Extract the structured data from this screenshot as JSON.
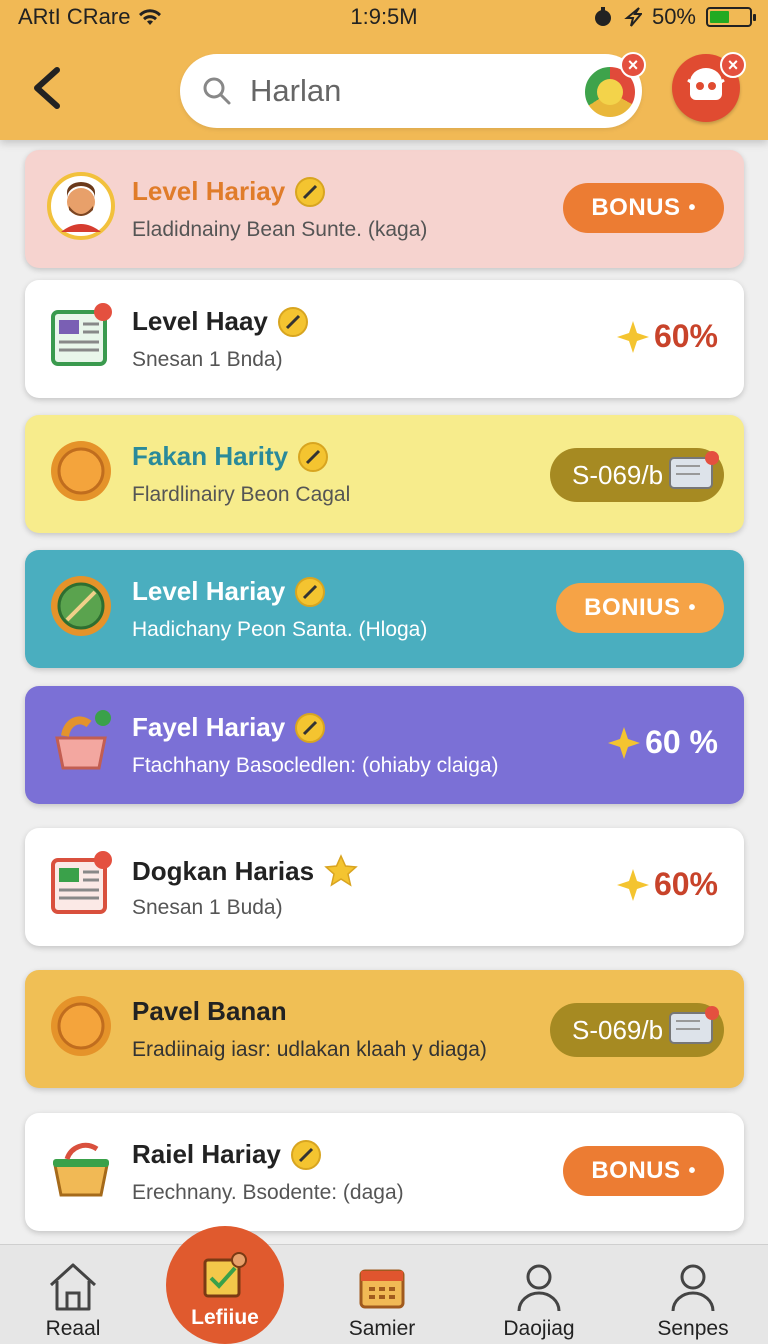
{
  "status_bar": {
    "carrier": "ARtI CRare",
    "time": "1:9:5M",
    "battery": "50%"
  },
  "header": {
    "search_value": "Harlan"
  },
  "cards": [
    {
      "title": "Level Hariay",
      "subtitle": "Eladidnainy Bean Sunte. (kaga)",
      "badge": "BONUS",
      "bg": "#f6d3cf"
    },
    {
      "title": "Level Haay",
      "subtitle": "Snesan 1 Bnda)",
      "percent": "60%",
      "bg": "#ffffff"
    },
    {
      "title": "Fakan Harity",
      "subtitle": "Flardlinairy Beon Cagal",
      "price": "S-069/b",
      "bg": "#f7ec8c"
    },
    {
      "title": "Level Hariay",
      "subtitle": "Hadichany Peon Santa. (Hloga)",
      "badge": "BONIUS",
      "bg": "#4aaebf"
    },
    {
      "title": "Fayel Hariay",
      "subtitle": "Ftachhany Basocledlen: (ohiaby claiga)",
      "percent": "60 %",
      "bg": "#7b70d6"
    },
    {
      "title": "Dogkan Harias",
      "subtitle": "Snesan 1 Buda)",
      "percent": "60%",
      "bg": "#ffffff"
    },
    {
      "title": "Pavel Banan",
      "subtitle": "Eradiinaig iasr: udlakan klaah y diaga)",
      "price": "S-069/b",
      "bg": "#f0bf55"
    },
    {
      "title": "Raiel Hariay",
      "subtitle": "Erechnany. Bsodente: (daga)",
      "badge": "BONUS",
      "bg": "#ffffff"
    }
  ],
  "nav": [
    {
      "label": "Reaal",
      "icon": "home-icon"
    },
    {
      "label": "Lefiiue",
      "icon": "task-icon",
      "active": true
    },
    {
      "label": "Samier",
      "icon": "calendar-icon"
    },
    {
      "label": "Daojiag",
      "icon": "person-icon"
    },
    {
      "label": "Senpes",
      "icon": "person-icon"
    }
  ]
}
